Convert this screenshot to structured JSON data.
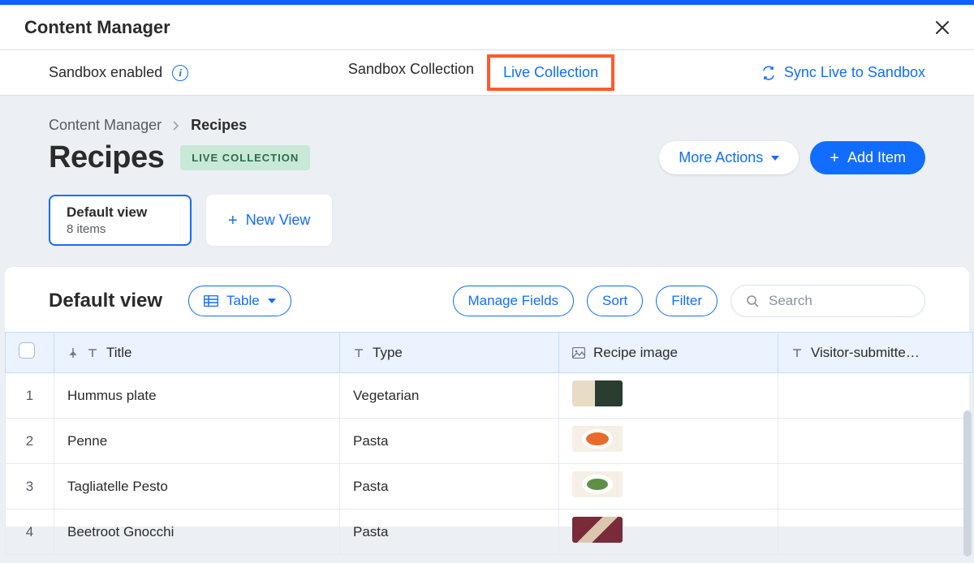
{
  "app": {
    "title": "Content Manager"
  },
  "secondbar": {
    "sandbox_label": "Sandbox enabled",
    "tab_sandbox": "Sandbox Collection",
    "tab_live": "Live Collection",
    "sync_label": "Sync Live to Sandbox"
  },
  "breadcrumb": {
    "root": "Content Manager",
    "current": "Recipes"
  },
  "page": {
    "title": "Recipes",
    "badge": "LIVE COLLECTION",
    "more_actions": "More Actions",
    "add_item": "Add Item"
  },
  "views": {
    "default_name": "Default view",
    "default_meta": "8 items",
    "new_view": "New View"
  },
  "toolbar": {
    "view_title": "Default view",
    "table_label": "Table",
    "manage_fields": "Manage Fields",
    "sort": "Sort",
    "filter": "Filter",
    "search_placeholder": "Search"
  },
  "columns": {
    "title": "Title",
    "type": "Type",
    "image": "Recipe image",
    "visitor": "Visitor-submitte…"
  },
  "rows": [
    {
      "n": "1",
      "title": "Hummus plate",
      "type": "Vegetarian"
    },
    {
      "n": "2",
      "title": "Penne",
      "type": "Pasta"
    },
    {
      "n": "3",
      "title": "Tagliatelle Pesto",
      "type": "Pasta"
    },
    {
      "n": "4",
      "title": "Beetroot Gnocchi",
      "type": "Pasta"
    }
  ]
}
